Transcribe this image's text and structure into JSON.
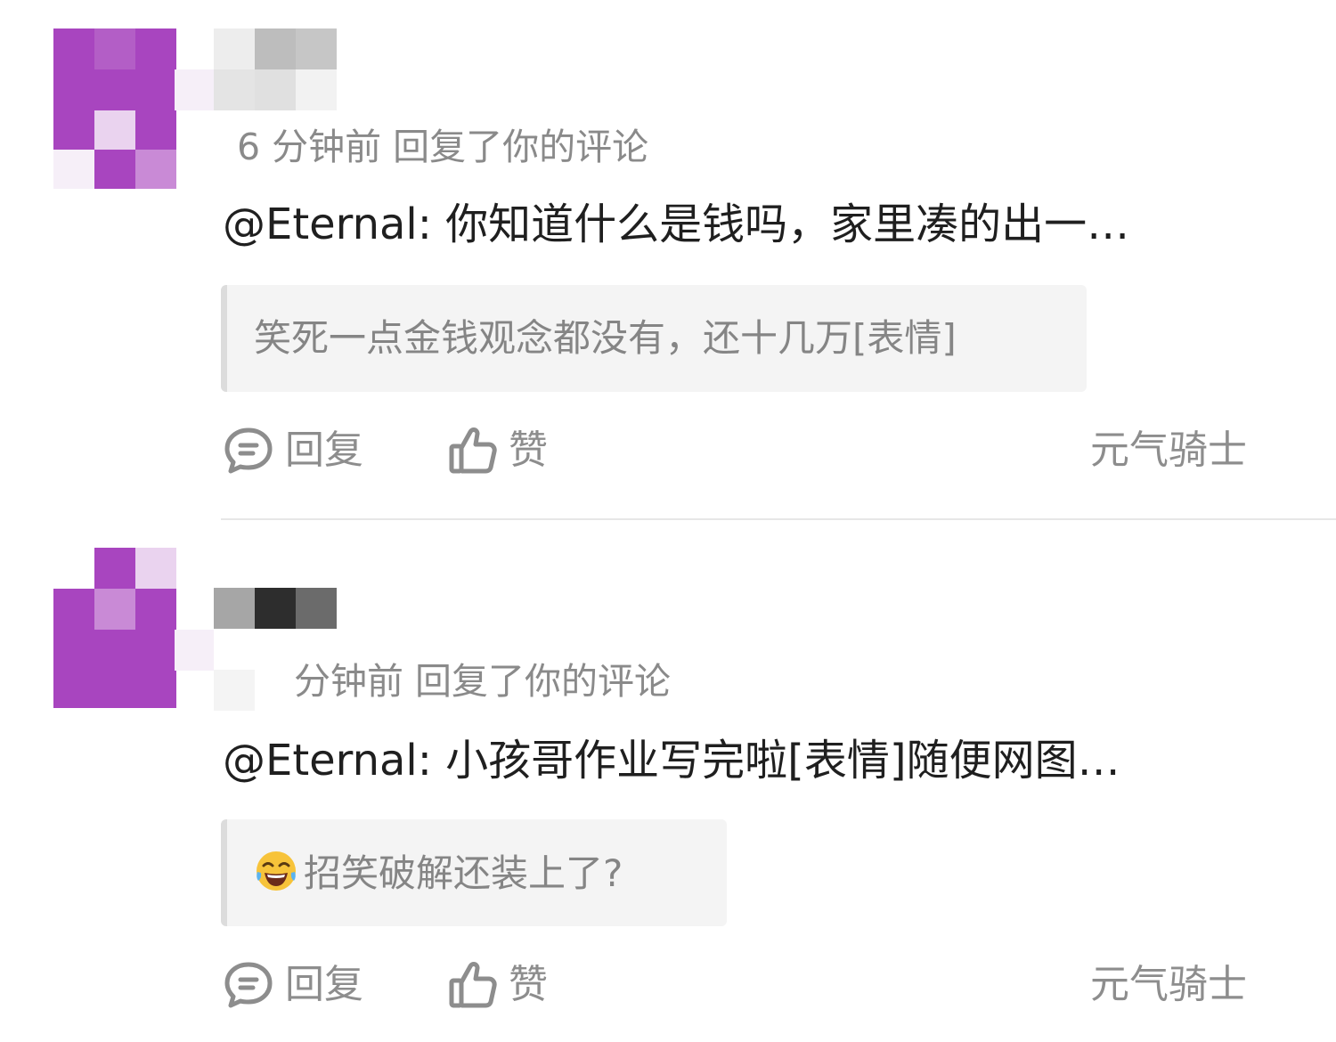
{
  "colors": {
    "avatar_primary": "#a845bf",
    "text_primary": "#1f1f1f",
    "text_secondary": "#8a8a8a",
    "quote_bg": "#f4f4f4",
    "divider": "#e7e7e7"
  },
  "notifications": [
    {
      "meta": "6 分钟前 回复了你的评论",
      "comment": "@Eternal: 你知道什么是钱吗，家里凑的出一…",
      "quote": "笑死一点金钱观念都没有，还十几万[表情]",
      "quote_emoji": "",
      "reply_label": "回复",
      "like_label": "赞",
      "source": "元气骑士"
    },
    {
      "meta": "分钟前 回复了你的评论",
      "comment": "@Eternal: 小孩哥作业写完啦[表情]随便网图…",
      "quote": "招笑破解还装上了?",
      "quote_emoji": "tears-of-joy-emoji",
      "reply_label": "回复",
      "like_label": "赞",
      "source": "元气骑士"
    }
  ]
}
